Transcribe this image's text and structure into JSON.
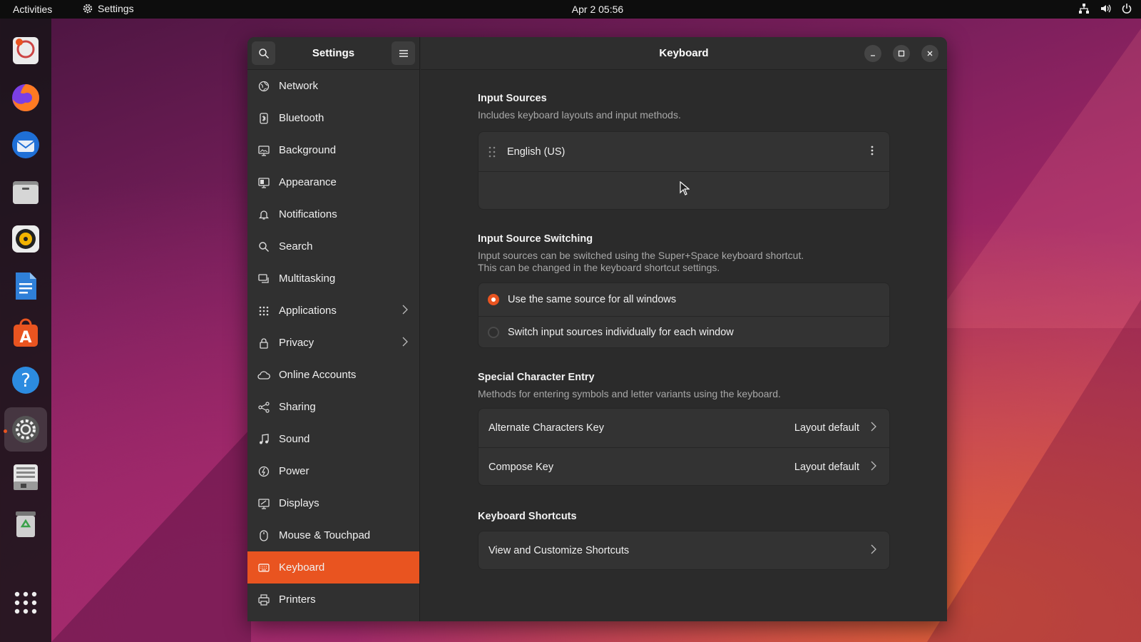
{
  "topbar": {
    "activities": "Activities",
    "app_name": "Settings",
    "clock": "Apr 2  05:56"
  },
  "dock": {
    "items": [
      "help-browser",
      "firefox",
      "thunderbird",
      "files",
      "rhythmbox",
      "libreoffice-writer",
      "ubuntu-software",
      "help",
      "settings",
      "disk-utility",
      "trash",
      "show-applications"
    ]
  },
  "sidebar": {
    "title": "Settings",
    "items": [
      {
        "label": "Network",
        "icon": "network-icon"
      },
      {
        "label": "Bluetooth",
        "icon": "bluetooth-icon"
      },
      {
        "label": "Background",
        "icon": "background-icon"
      },
      {
        "label": "Appearance",
        "icon": "appearance-icon"
      },
      {
        "label": "Notifications",
        "icon": "bell-icon"
      },
      {
        "label": "Search",
        "icon": "search-icon"
      },
      {
        "label": "Multitasking",
        "icon": "multitasking-icon"
      },
      {
        "label": "Applications",
        "icon": "grid-icon"
      },
      {
        "label": "Privacy",
        "icon": "lock-icon"
      },
      {
        "label": "Online Accounts",
        "icon": "cloud-icon"
      },
      {
        "label": "Sharing",
        "icon": "share-icon"
      },
      {
        "label": "Sound",
        "icon": "music-icon"
      },
      {
        "label": "Power",
        "icon": "power-icon"
      },
      {
        "label": "Displays",
        "icon": "display-icon"
      },
      {
        "label": "Mouse & Touchpad",
        "icon": "mouse-icon"
      },
      {
        "label": "Keyboard",
        "icon": "keyboard-icon"
      },
      {
        "label": "Printers",
        "icon": "printer-icon"
      }
    ]
  },
  "main": {
    "title": "Keyboard",
    "input_sources": {
      "title": "Input Sources",
      "subtitle": "Includes keyboard layouts and input methods.",
      "source": "English (US)"
    },
    "switching": {
      "title": "Input Source Switching",
      "subtitle_line1": "Input sources can be switched using the Super+Space keyboard shortcut.",
      "subtitle_line2": "This can be changed in the keyboard shortcut settings.",
      "option_same": "Use the same source for all windows",
      "option_individual": "Switch input sources individually for each window"
    },
    "special": {
      "title": "Special Character Entry",
      "subtitle": "Methods for entering symbols and letter variants using the keyboard.",
      "alt_label": "Alternate Characters Key",
      "alt_value": "Layout default",
      "compose_label": "Compose Key",
      "compose_value": "Layout default"
    },
    "shortcuts": {
      "title": "Keyboard Shortcuts",
      "view_label": "View and Customize Shortcuts"
    }
  },
  "colors": {
    "accent": "#e95420",
    "window_bg": "#2b2b2b",
    "sidebar_bg": "#303030",
    "topbar_bg": "#0d0d0d"
  }
}
